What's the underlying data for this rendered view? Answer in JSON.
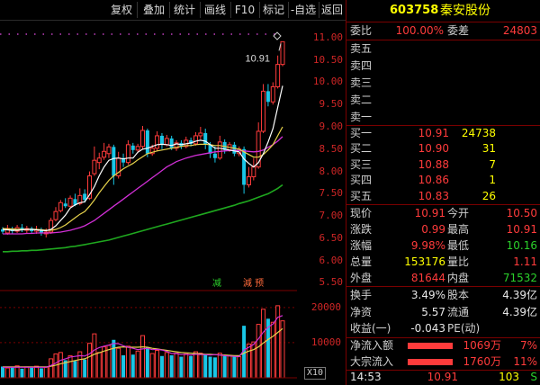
{
  "toolbar": {
    "buttons": [
      "复权",
      "叠加",
      "统计",
      "画线",
      "F10",
      "标记",
      "-自选",
      "返回"
    ]
  },
  "colors": {
    "up": "#ff3b3b",
    "down": "#19c6e6",
    "ma5": "#ffffff",
    "ma10": "#e8d44c",
    "ma20": "#d12fd6",
    "ma60": "#1fa81f",
    "price_axis": "#d02626",
    "volume_grid": "#7a0000"
  },
  "chart_data": {
    "type": "candlestick",
    "ylim": [
      5.55,
      11.2
    ],
    "yticks": [
      "11.00",
      "10.50",
      "10.00",
      "9.50",
      "9.00",
      "8.50",
      "8.00",
      "7.50",
      "7.00",
      "6.50",
      "6.00",
      "5.50"
    ],
    "high_annotation": "10.91",
    "candles": [
      {
        "o": 6.7,
        "c": 6.65,
        "h": 6.75,
        "l": 6.6
      },
      {
        "o": 6.62,
        "c": 6.72,
        "h": 6.8,
        "l": 6.58
      },
      {
        "o": 6.7,
        "c": 6.66,
        "h": 6.76,
        "l": 6.6
      },
      {
        "o": 6.66,
        "c": 6.74,
        "h": 6.8,
        "l": 6.62
      },
      {
        "o": 6.74,
        "c": 6.68,
        "h": 6.82,
        "l": 6.64
      },
      {
        "o": 6.68,
        "c": 6.72,
        "h": 6.78,
        "l": 6.62
      },
      {
        "o": 6.72,
        "c": 6.66,
        "h": 6.76,
        "l": 6.6
      },
      {
        "o": 6.66,
        "c": 6.7,
        "h": 6.78,
        "l": 6.6
      },
      {
        "o": 6.7,
        "c": 6.62,
        "h": 6.74,
        "l": 6.56
      },
      {
        "o": 6.6,
        "c": 6.64,
        "h": 6.72,
        "l": 6.52
      },
      {
        "o": 6.64,
        "c": 6.9,
        "h": 6.96,
        "l": 6.6
      },
      {
        "o": 6.92,
        "c": 7.1,
        "h": 7.2,
        "l": 6.88
      },
      {
        "o": 7.12,
        "c": 7.3,
        "h": 7.36,
        "l": 7.08
      },
      {
        "o": 7.28,
        "c": 7.22,
        "h": 7.4,
        "l": 7.18
      },
      {
        "o": 7.22,
        "c": 7.4,
        "h": 7.46,
        "l": 7.2
      },
      {
        "o": 7.38,
        "c": 7.25,
        "h": 7.5,
        "l": 7.22
      },
      {
        "o": 7.28,
        "c": 7.46,
        "h": 7.62,
        "l": 7.24
      },
      {
        "o": 7.5,
        "c": 7.36,
        "h": 7.6,
        "l": 7.3
      },
      {
        "o": 7.4,
        "c": 7.9,
        "h": 8.0,
        "l": 7.36
      },
      {
        "o": 7.95,
        "c": 8.25,
        "h": 8.56,
        "l": 7.9
      },
      {
        "o": 8.2,
        "c": 8.3,
        "h": 8.42,
        "l": 8.05
      },
      {
        "o": 8.32,
        "c": 8.45,
        "h": 8.64,
        "l": 8.26
      },
      {
        "o": 8.4,
        "c": 8.55,
        "h": 8.62,
        "l": 8.3
      },
      {
        "o": 8.55,
        "c": 7.9,
        "h": 8.6,
        "l": 7.7
      },
      {
        "o": 7.9,
        "c": 8.3,
        "h": 8.44,
        "l": 7.84
      },
      {
        "o": 8.3,
        "c": 8.2,
        "h": 8.4,
        "l": 8.1
      },
      {
        "o": 8.2,
        "c": 8.6,
        "h": 8.7,
        "l": 8.15
      },
      {
        "o": 8.58,
        "c": 8.48,
        "h": 8.64,
        "l": 8.4
      },
      {
        "o": 8.48,
        "c": 8.56,
        "h": 8.62,
        "l": 8.42
      },
      {
        "o": 8.56,
        "c": 8.92,
        "h": 9.02,
        "l": 8.5
      },
      {
        "o": 8.92,
        "c": 8.4,
        "h": 8.96,
        "l": 8.32
      },
      {
        "o": 8.4,
        "c": 8.52,
        "h": 8.6,
        "l": 8.35
      },
      {
        "o": 8.52,
        "c": 8.8,
        "h": 8.9,
        "l": 8.45
      },
      {
        "o": 8.8,
        "c": 8.6,
        "h": 8.86,
        "l": 8.5
      },
      {
        "o": 8.6,
        "c": 8.74,
        "h": 8.82,
        "l": 8.56
      },
      {
        "o": 8.74,
        "c": 8.52,
        "h": 8.8,
        "l": 8.48
      },
      {
        "o": 8.52,
        "c": 8.64,
        "h": 8.7,
        "l": 8.46
      },
      {
        "o": 8.64,
        "c": 8.56,
        "h": 8.7,
        "l": 8.5
      },
      {
        "o": 8.56,
        "c": 8.7,
        "h": 8.78,
        "l": 8.52
      },
      {
        "o": 8.7,
        "c": 8.62,
        "h": 8.76,
        "l": 8.56
      },
      {
        "o": 8.62,
        "c": 8.8,
        "h": 8.88,
        "l": 8.58
      },
      {
        "o": 8.8,
        "c": 8.86,
        "h": 9.0,
        "l": 8.72
      },
      {
        "o": 8.86,
        "c": 8.6,
        "h": 8.96,
        "l": 8.5
      },
      {
        "o": 8.6,
        "c": 8.4,
        "h": 8.66,
        "l": 8.3
      },
      {
        "o": 8.4,
        "c": 8.3,
        "h": 8.56,
        "l": 8.2
      },
      {
        "o": 8.3,
        "c": 8.66,
        "h": 8.8,
        "l": 8.26
      },
      {
        "o": 8.66,
        "c": 8.48,
        "h": 8.72,
        "l": 8.4
      },
      {
        "o": 8.48,
        "c": 8.6,
        "h": 8.66,
        "l": 8.44
      },
      {
        "o": 8.6,
        "c": 8.4,
        "h": 8.66,
        "l": 8.34
      },
      {
        "o": 8.4,
        "c": 8.5,
        "h": 8.56,
        "l": 8.34
      },
      {
        "o": 8.5,
        "c": 7.7,
        "h": 8.56,
        "l": 7.5
      },
      {
        "o": 7.7,
        "c": 7.88,
        "h": 8.1,
        "l": 7.64
      },
      {
        "o": 7.88,
        "c": 8.1,
        "h": 8.3,
        "l": 7.8
      },
      {
        "o": 8.1,
        "c": 8.9,
        "h": 9.1,
        "l": 8.06
      },
      {
        "o": 8.9,
        "c": 9.8,
        "h": 9.96,
        "l": 8.86
      },
      {
        "o": 9.8,
        "c": 9.56,
        "h": 9.96,
        "l": 9.46
      },
      {
        "o": 9.56,
        "c": 9.9,
        "h": 10.0,
        "l": 9.5
      },
      {
        "o": 9.9,
        "c": 10.4,
        "h": 10.6,
        "l": 9.86
      },
      {
        "o": 10.4,
        "c": 10.91,
        "h": 10.91,
        "l": 10.36
      }
    ],
    "ma5": [
      6.7,
      6.69,
      6.68,
      6.68,
      6.69,
      6.7,
      6.7,
      6.69,
      6.68,
      6.67,
      6.7,
      6.78,
      6.9,
      7.02,
      7.18,
      7.25,
      7.3,
      7.32,
      7.48,
      7.66,
      7.9,
      8.1,
      8.25,
      8.29,
      8.3,
      8.28,
      8.3,
      8.3,
      8.43,
      8.5,
      8.52,
      8.56,
      8.6,
      8.61,
      8.6,
      8.58,
      8.62,
      8.6,
      8.62,
      8.64,
      8.68,
      8.7,
      8.68,
      8.6,
      8.52,
      8.52,
      8.5,
      8.48,
      8.46,
      8.44,
      8.28,
      8.18,
      8.1,
      8.2,
      8.4,
      8.66,
      8.96,
      9.44,
      9.92
    ],
    "ma10": [
      6.72,
      6.71,
      6.71,
      6.7,
      6.7,
      6.7,
      6.7,
      6.7,
      6.69,
      6.68,
      6.68,
      6.7,
      6.74,
      6.8,
      6.88,
      6.96,
      7.04,
      7.1,
      7.22,
      7.36,
      7.52,
      7.66,
      7.8,
      7.9,
      7.98,
      8.06,
      8.12,
      8.18,
      8.26,
      8.33,
      8.4,
      8.43,
      8.46,
      8.48,
      8.5,
      8.52,
      8.54,
      8.56,
      8.58,
      8.58,
      8.6,
      8.61,
      8.61,
      8.6,
      8.58,
      8.58,
      8.56,
      8.54,
      8.52,
      8.5,
      8.44,
      8.38,
      8.32,
      8.32,
      8.38,
      8.48,
      8.6,
      8.8,
      9.0
    ],
    "ma20": [
      6.6,
      6.6,
      6.6,
      6.6,
      6.6,
      6.61,
      6.61,
      6.62,
      6.62,
      6.62,
      6.62,
      6.63,
      6.64,
      6.66,
      6.68,
      6.71,
      6.74,
      6.78,
      6.84,
      6.9,
      6.98,
      7.06,
      7.14,
      7.22,
      7.3,
      7.38,
      7.46,
      7.54,
      7.62,
      7.7,
      7.78,
      7.86,
      7.94,
      8.02,
      8.1,
      8.16,
      8.22,
      8.26,
      8.3,
      8.33,
      8.36,
      8.38,
      8.4,
      8.42,
      8.44,
      8.45,
      8.46,
      8.47,
      8.47,
      8.47,
      8.46,
      8.45,
      8.44,
      8.45,
      8.48,
      8.54,
      8.6,
      8.68,
      8.78
    ],
    "ma60": [
      6.2,
      6.2,
      6.21,
      6.21,
      6.22,
      6.22,
      6.23,
      6.23,
      6.24,
      6.25,
      6.26,
      6.27,
      6.28,
      6.29,
      6.31,
      6.32,
      6.34,
      6.36,
      6.38,
      6.4,
      6.42,
      6.44,
      6.46,
      6.49,
      6.52,
      6.55,
      6.58,
      6.61,
      6.64,
      6.67,
      6.7,
      6.73,
      6.76,
      6.79,
      6.82,
      6.85,
      6.88,
      6.91,
      6.94,
      6.97,
      7.0,
      7.03,
      7.06,
      7.09,
      7.12,
      7.15,
      7.18,
      7.21,
      7.24,
      7.28,
      7.31,
      7.34,
      7.38,
      7.42,
      7.46,
      7.5,
      7.56,
      7.62,
      7.7
    ],
    "signals": [
      "减",
      "減 预"
    ],
    "volume": {
      "yticks": [
        "20000",
        "10000"
      ],
      "ylim": [
        0,
        22000
      ],
      "multiplier": "X10",
      "bars": [
        3200,
        2800,
        3000,
        3400,
        2600,
        3100,
        2900,
        3300,
        2700,
        3000,
        5400,
        6800,
        7200,
        5000,
        6300,
        4800,
        7400,
        5200,
        9800,
        12500,
        7200,
        8800,
        9200,
        10800,
        8400,
        6400,
        9000,
        6600,
        7600,
        12000,
        8600,
        6900,
        7800,
        6200,
        7200,
        6400,
        7000,
        6000,
        6800,
        6200,
        7400,
        7000,
        6600,
        6000,
        5800,
        7000,
        6200,
        6400,
        6400,
        6000,
        14800,
        9600,
        10200,
        15200,
        19500,
        16800,
        15800,
        20500,
        16200
      ],
      "ma5": [
        3000,
        3000,
        3000,
        3000,
        3000,
        3000,
        3000,
        3000,
        3000,
        3000,
        3500,
        4200,
        5000,
        5400,
        5900,
        6100,
        6300,
        6200,
        6800,
        7900,
        8600,
        9000,
        9300,
        9800,
        9700,
        9100,
        8700,
        8400,
        8000,
        8200,
        8400,
        8000,
        8100,
        7900,
        7500,
        6900,
        6900,
        6600,
        6700,
        6500,
        6700,
        6600,
        6600,
        6500,
        6600,
        6500,
        6300,
        6200,
        6100,
        6000,
        7900,
        8700,
        9500,
        11100,
        13000,
        14400,
        15300,
        17200,
        17700
      ],
      "ma10": [
        3100,
        3100,
        3100,
        3100,
        3100,
        3100,
        3100,
        3100,
        3100,
        3100,
        3300,
        3600,
        4000,
        4300,
        4600,
        4900,
        5200,
        5400,
        6000,
        6700,
        7100,
        7600,
        8000,
        8400,
        8700,
        8800,
        8700,
        8700,
        8700,
        8800,
        8700,
        8400,
        8200,
        8000,
        7800,
        7600,
        7400,
        7200,
        7100,
        7000,
        6900,
        6800,
        6700,
        6700,
        6600,
        6500,
        6500,
        6400,
        6300,
        6300,
        7000,
        7600,
        8000,
        8800,
        9900,
        10900,
        11800,
        12900,
        14000
      ]
    }
  },
  "quote": {
    "code": "603758",
    "name": "秦安股份",
    "weibi_label": "委比",
    "weibi_value": "100.00%",
    "weicha_label": "委差",
    "weicha_value": "24803",
    "asks": [
      {
        "label": "卖五",
        "price": "",
        "vol": ""
      },
      {
        "label": "卖四",
        "price": "",
        "vol": ""
      },
      {
        "label": "卖三",
        "price": "",
        "vol": ""
      },
      {
        "label": "卖二",
        "price": "",
        "vol": ""
      },
      {
        "label": "卖一",
        "price": "",
        "vol": ""
      }
    ],
    "bids": [
      {
        "label": "买一",
        "price": "10.91",
        "vol": "24738"
      },
      {
        "label": "买二",
        "price": "10.90",
        "vol": "31"
      },
      {
        "label": "买三",
        "price": "10.88",
        "vol": "7"
      },
      {
        "label": "买四",
        "price": "10.86",
        "vol": "1"
      },
      {
        "label": "买五",
        "price": "10.83",
        "vol": "26"
      }
    ],
    "stats": [
      {
        "l1": "现价",
        "v1": "10.91",
        "l2": "今开",
        "v2": "10.50"
      },
      {
        "l1": "涨跌",
        "v1": "0.99",
        "l2": "最高",
        "v2": "10.91"
      },
      {
        "l1": "涨幅",
        "v1": "9.98%",
        "l2": "最低",
        "v2": "10.16"
      },
      {
        "l1": "总量",
        "v1": "153176",
        "l2": "量比",
        "v2": "1.11"
      },
      {
        "l1": "外盘",
        "v1": "81644",
        "l2": "内盘",
        "v2": "71532"
      }
    ],
    "fund": [
      {
        "l1": "换手",
        "v1": "3.49%",
        "l2": "股本",
        "v2": "4.39亿"
      },
      {
        "l1": "净资",
        "v1": "5.57",
        "l2": "流通",
        "v2": "4.39亿"
      },
      {
        "l1": "收益(一)",
        "v1": "-0.043",
        "l2": "PE(动)",
        "v2": ""
      }
    ],
    "flows": [
      {
        "label": "净流入额",
        "amount": "1069万",
        "pct": "7%"
      },
      {
        "label": "大宗流入",
        "amount": "1760万",
        "pct": "11%"
      }
    ],
    "tick": {
      "time": "14:53",
      "price": "10.91",
      "vol": "103",
      "dir": "S"
    }
  }
}
